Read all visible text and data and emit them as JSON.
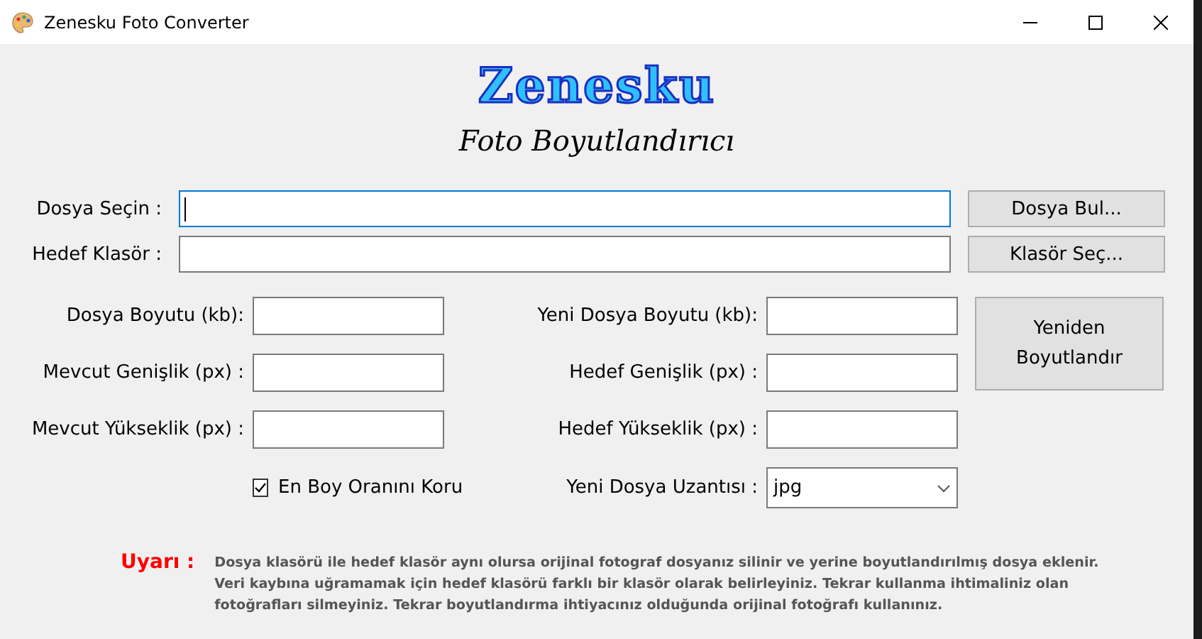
{
  "window": {
    "title": "Zenesku Foto Converter"
  },
  "header": {
    "logo": "Zenesku",
    "subtitle": "Foto Boyutlandırıcı"
  },
  "path_rows": [
    {
      "label": "Dosya Seçin :",
      "focused": true,
      "button": "Dosya Bul..."
    },
    {
      "label": "Hedef Klasör :",
      "focused": false,
      "button": "Klasör Seç..."
    }
  ],
  "left_fields": [
    {
      "label": "Dosya Boyutu (kb):"
    },
    {
      "label": "Mevcut Genişlik (px) :"
    },
    {
      "label": "Mevcut Yükseklik (px) :"
    }
  ],
  "aspect_checkbox": {
    "label": "En Boy Oranını Koru",
    "checked": true
  },
  "right_fields": [
    {
      "label": "Yeni Dosya Boyutu (kb):"
    },
    {
      "label": "Hedef Genişlik (px) :"
    },
    {
      "label": "Hedef Yükseklik (px) :"
    }
  ],
  "extension": {
    "label": "Yeni Dosya Uzantısı :",
    "value": "jpg"
  },
  "resize_button": {
    "lines": [
      "Yeniden",
      "Boyutlandır"
    ]
  },
  "warning": {
    "title": "Uyarı :",
    "lines": [
      "Dosya klasörü ile hedef klasör aynı olursa orijinal fotograf dosyanız silinir ve yerine boyutlandırılmış dosya eklenir.",
      "Veri kaybına uğramamak için hedef klasörü farklı bir klasör olarak belirleyiniz. Tekrar kullanma ihtimaliniz olan",
      "fotoğrafları silmeyiniz. Tekrar boyutlandırma ihtiyacınız olduğunda orijinal fotoğrafı kullanınız."
    ]
  }
}
